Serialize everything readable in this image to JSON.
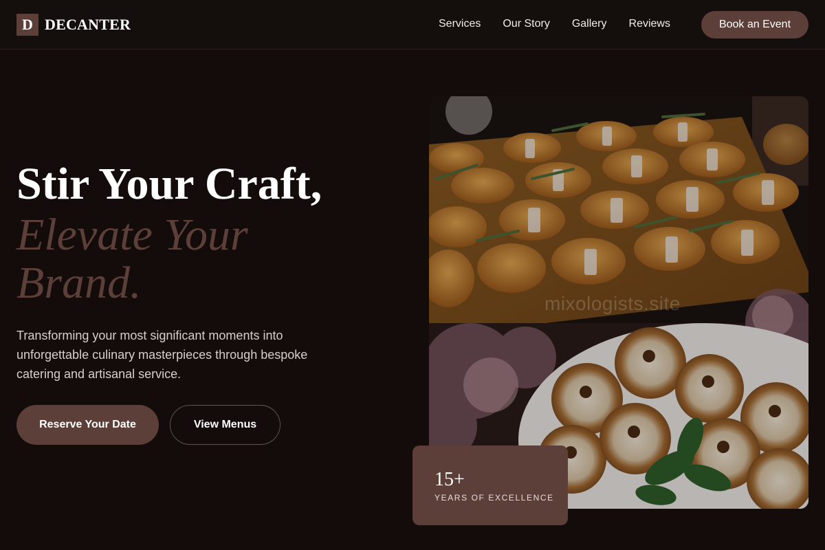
{
  "brand": {
    "mark": "D",
    "name": "DECANTER"
  },
  "nav": {
    "items": [
      "Services",
      "Our Story",
      "Gallery",
      "Reviews"
    ],
    "cta": "Book an Event"
  },
  "hero": {
    "title_line1": "Stir Your Craft,",
    "title_line2": "Elevate Your",
    "title_line3": "Brand.",
    "lead": "Transforming your most significant moments into unforgettable culinary masterpieces through bespoke catering and artisanal service.",
    "primary_cta": "Reserve Your Date",
    "secondary_cta": "View Menus"
  },
  "image": {
    "watermark": "mixologists.site"
  },
  "stat": {
    "value": "15+",
    "label": "YEARS OF EXCELLENCE"
  },
  "colors": {
    "background": "#130c0b",
    "accent": "#5c3f38",
    "text": "#ffffff",
    "muted": "#d6cfcc"
  }
}
